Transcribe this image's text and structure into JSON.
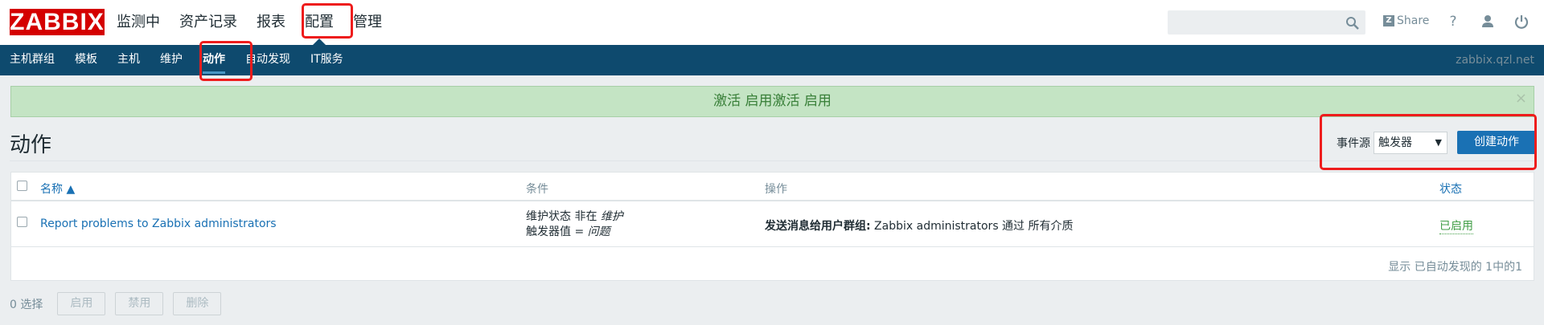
{
  "header": {
    "logo": "ZABBIX",
    "nav": [
      {
        "label": "监测中"
      },
      {
        "label": "资产记录"
      },
      {
        "label": "报表"
      },
      {
        "label": "配置"
      },
      {
        "label": "管理"
      }
    ],
    "search_value": "",
    "share_label": "Share",
    "share_icon": "Z",
    "help_icon": "?"
  },
  "subnav": {
    "items": [
      {
        "label": "主机群组"
      },
      {
        "label": "模板"
      },
      {
        "label": "主机"
      },
      {
        "label": "维护"
      },
      {
        "label": "动作"
      },
      {
        "label": "自动发现"
      },
      {
        "label": "IT服务"
      }
    ],
    "hostname": "zabbix.qzl.net"
  },
  "message": {
    "text": "激活 启用激活 启用",
    "close": "×"
  },
  "page": {
    "title": "动作",
    "filter_label": "事件源",
    "filter_value": "触发器",
    "create_button": "创建动作"
  },
  "table": {
    "headers": {
      "name": "名称 ▲",
      "conditions": "条件",
      "operations": "操作",
      "status": "状态"
    },
    "rows": [
      {
        "name": "Report problems to Zabbix administrators",
        "cond1_prefix": "维护状态 非在 ",
        "cond1_value": "维护",
        "cond2_prefix": "触发器值 = ",
        "cond2_value": "问题",
        "op_bold": "发送消息给用户群组:",
        "op_rest": " Zabbix administrators 通过 所有介质",
        "status": "已启用"
      }
    ],
    "footer": "显示 已自动发现的 1中的1"
  },
  "actions": {
    "selected": "0 选择",
    "enable": "启用",
    "disable": "禁用",
    "delete": "删除"
  }
}
